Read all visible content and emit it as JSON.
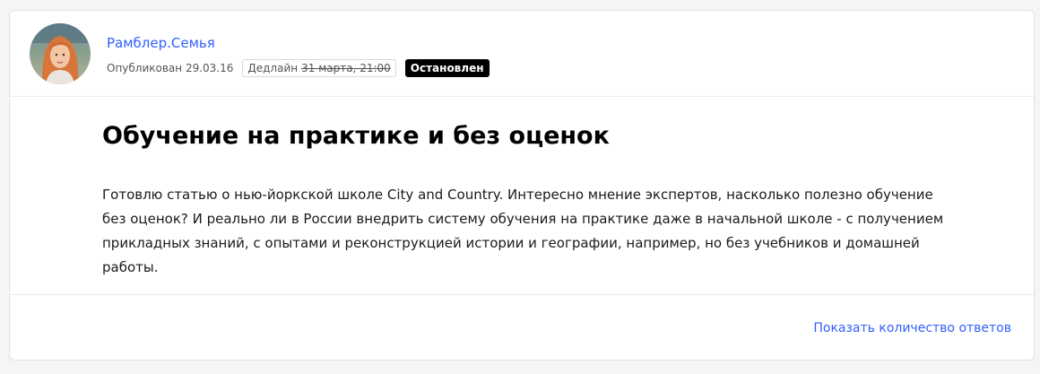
{
  "author": {
    "name": "Рамблер.Семья"
  },
  "meta": {
    "published": "Опубликован 29.03.16",
    "deadline_label": "Дедлайн",
    "deadline_date": "31 марта, 21:00",
    "status": "Остановлен"
  },
  "question": {
    "title": "Обучение на практике и без оценок",
    "body": "Готовлю статью о нью-йоркской школе City and Country. Интересно мнение экспертов, насколько полезно обучение без оценок? И реально ли в России внедрить систему обучения на практике даже в начальной школе - с получением прикладных знаний, с опытами и реконструкцией истории и географии, например, но без учебников и домашней работы."
  },
  "footer": {
    "answers_link": "Показать количество ответов"
  },
  "colors": {
    "link": "#315efb",
    "badge_bg": "#000000",
    "badge_text": "#ffffff"
  }
}
